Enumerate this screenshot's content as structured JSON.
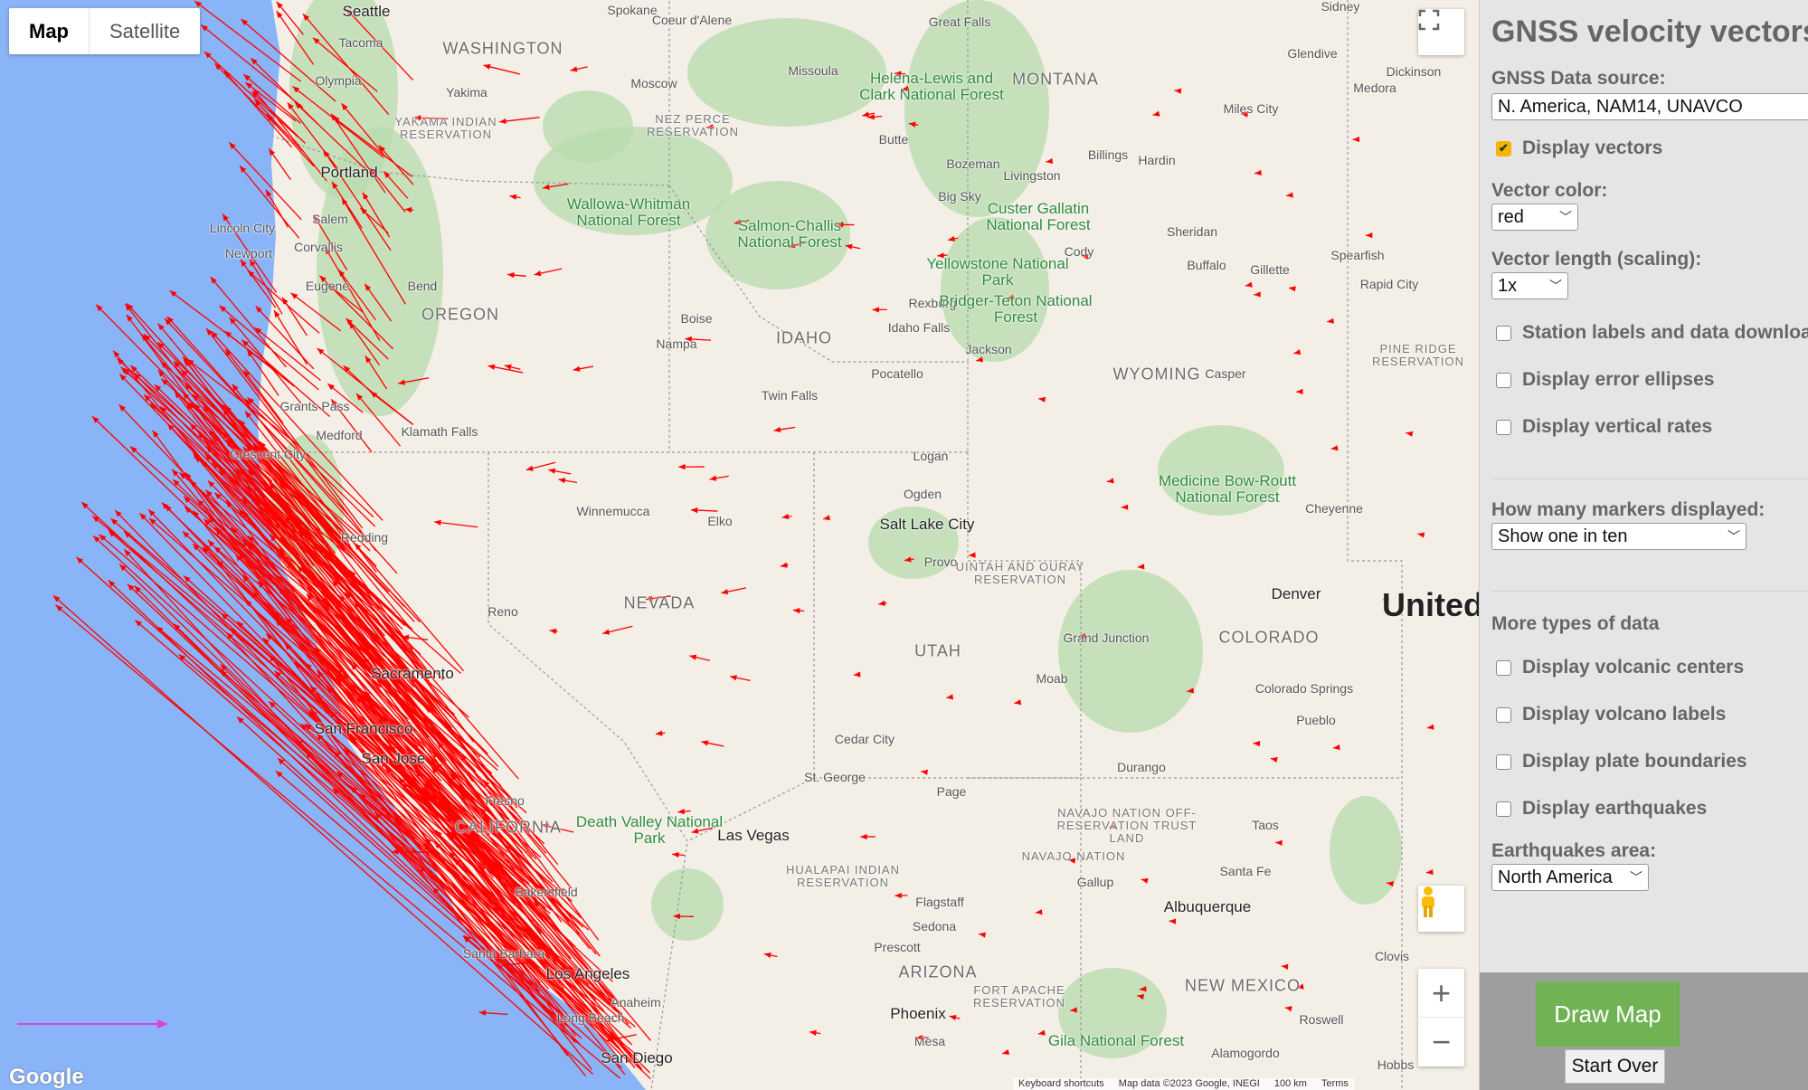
{
  "map": {
    "type_buttons": [
      "Map",
      "Satellite"
    ],
    "selected_type": "Map",
    "labels": {
      "states": [
        "WASHINGTON",
        "OREGON",
        "IDAHO",
        "MONTANA",
        "WYOMING",
        "NEVADA",
        "UTAH",
        "COLORADO",
        "CALIFORNIA",
        "ARIZONA",
        "NEW MEXICO"
      ],
      "cities": [
        "Seattle",
        "Tacoma",
        "Olympia",
        "Spokane",
        "Coeur d'Alene",
        "Moscow",
        "Yakima",
        "Portland",
        "Salem",
        "Lincoln City",
        "Newport",
        "Corvallis",
        "Eugene",
        "Bend",
        "Grants Pass",
        "Medford",
        "Klamath Falls",
        "Crescent City",
        "Redding",
        "Sacramento",
        "San Francisco",
        "San Jose",
        "Reno",
        "Fresno",
        "Bakersfield",
        "Santa Barbara",
        "Los Angeles",
        "Anaheim",
        "Long Beach",
        "San Diego",
        "Winnemucca",
        "Elko",
        "Las Vegas",
        "Boise",
        "Nampa",
        "Twin Falls",
        "Pocatello",
        "Idaho Falls",
        "Rexburg",
        "Missoula",
        "Butte",
        "Bozeman",
        "Livingston",
        "Big Sky",
        "Great Falls",
        "Billings",
        "Hardin",
        "Glendive",
        "Miles City",
        "Sidney",
        "Dickinson",
        "Medora",
        "Sheridan",
        "Cody",
        "Buffalo",
        "Gillette",
        "Spearfish",
        "Rapid City",
        "Casper",
        "Jackson",
        "Cheyenne",
        "Logan",
        "Ogden",
        "Salt Lake City",
        "Provo",
        "Denver",
        "Grand Junction",
        "Colorado Springs",
        "Pueblo",
        "Moab",
        "Durango",
        "Cedar City",
        "St. George",
        "Page",
        "Taos",
        "Santa Fe",
        "Gallup",
        "Albuquerque",
        "Flagstaff",
        "Sedona",
        "Prescott",
        "Phoenix",
        "Mesa",
        "Roswell",
        "Clovis",
        "Alamogordo",
        "Hobbs"
      ],
      "parks": [
        "Helena-Lewis and Clark National Forest",
        "Wallowa-Whitman National Forest",
        "Salmon-Challis National Forest",
        "Custer Gallatin National Forest",
        "Yellowstone National Park",
        "Bridger-Teton National Forest",
        "Medicine Bow-Routt National Forest",
        "Death Valley National Park",
        "Gila National Forest"
      ],
      "reservations": [
        "YAKAMA INDIAN RESERVATION",
        "NEZ PERCE RESERVATION",
        "UINTAH AND OURAY RESERVATION",
        "NAVAJO NATION OFF-RESERVATION TRUST LAND",
        "NAVAJO NATION",
        "HUALAPAI INDIAN RESERVATION",
        "FORT APACHE RESERVATION",
        "PINE RIDGE RESERVATION"
      ],
      "country": "United"
    },
    "vector_color": "#ff0000",
    "scale_arrow_color": "#e040e0",
    "icons": {
      "fullscreen": "fullscreen-icon",
      "pegman": "pegman-icon",
      "zoom_in": "+",
      "zoom_out": "−"
    },
    "logo": "Google",
    "attribution": [
      "Keyboard shortcuts",
      "Map data ©2023 Google, INEGI",
      "100 km",
      "Terms"
    ]
  },
  "panel": {
    "title": "GNSS velocity vectors",
    "data_source_label": "GNSS Data source:",
    "data_source_value": "N. America, NAM14, UNAVCO",
    "display_vectors": {
      "label": "Display vectors",
      "checked": true
    },
    "vector_color_label": "Vector color:",
    "vector_color_value": "red",
    "vector_length_label": "Vector length (scaling):",
    "vector_length_value": "1x",
    "options1": [
      {
        "label": "Station labels and data download",
        "checked": false
      },
      {
        "label": "Display error ellipses",
        "checked": false
      },
      {
        "label": "Display vertical rates",
        "checked": false
      }
    ],
    "markers_label": "How many markers displayed:",
    "markers_value": "Show one in ten",
    "more_types_heading": "More types of data",
    "options2": [
      {
        "label": "Display volcanic centers",
        "checked": false
      },
      {
        "label": "Display volcano labels",
        "checked": false
      },
      {
        "label": "Display plate boundaries",
        "checked": false
      },
      {
        "label": "Display earthquakes",
        "checked": false
      }
    ],
    "eq_area_label": "Earthquakes area:",
    "eq_area_value": "North America",
    "draw_map": "Draw Map",
    "start_over": "Start Over",
    "accent_color": "#71b255",
    "checkbox_color": "#f5b400"
  }
}
